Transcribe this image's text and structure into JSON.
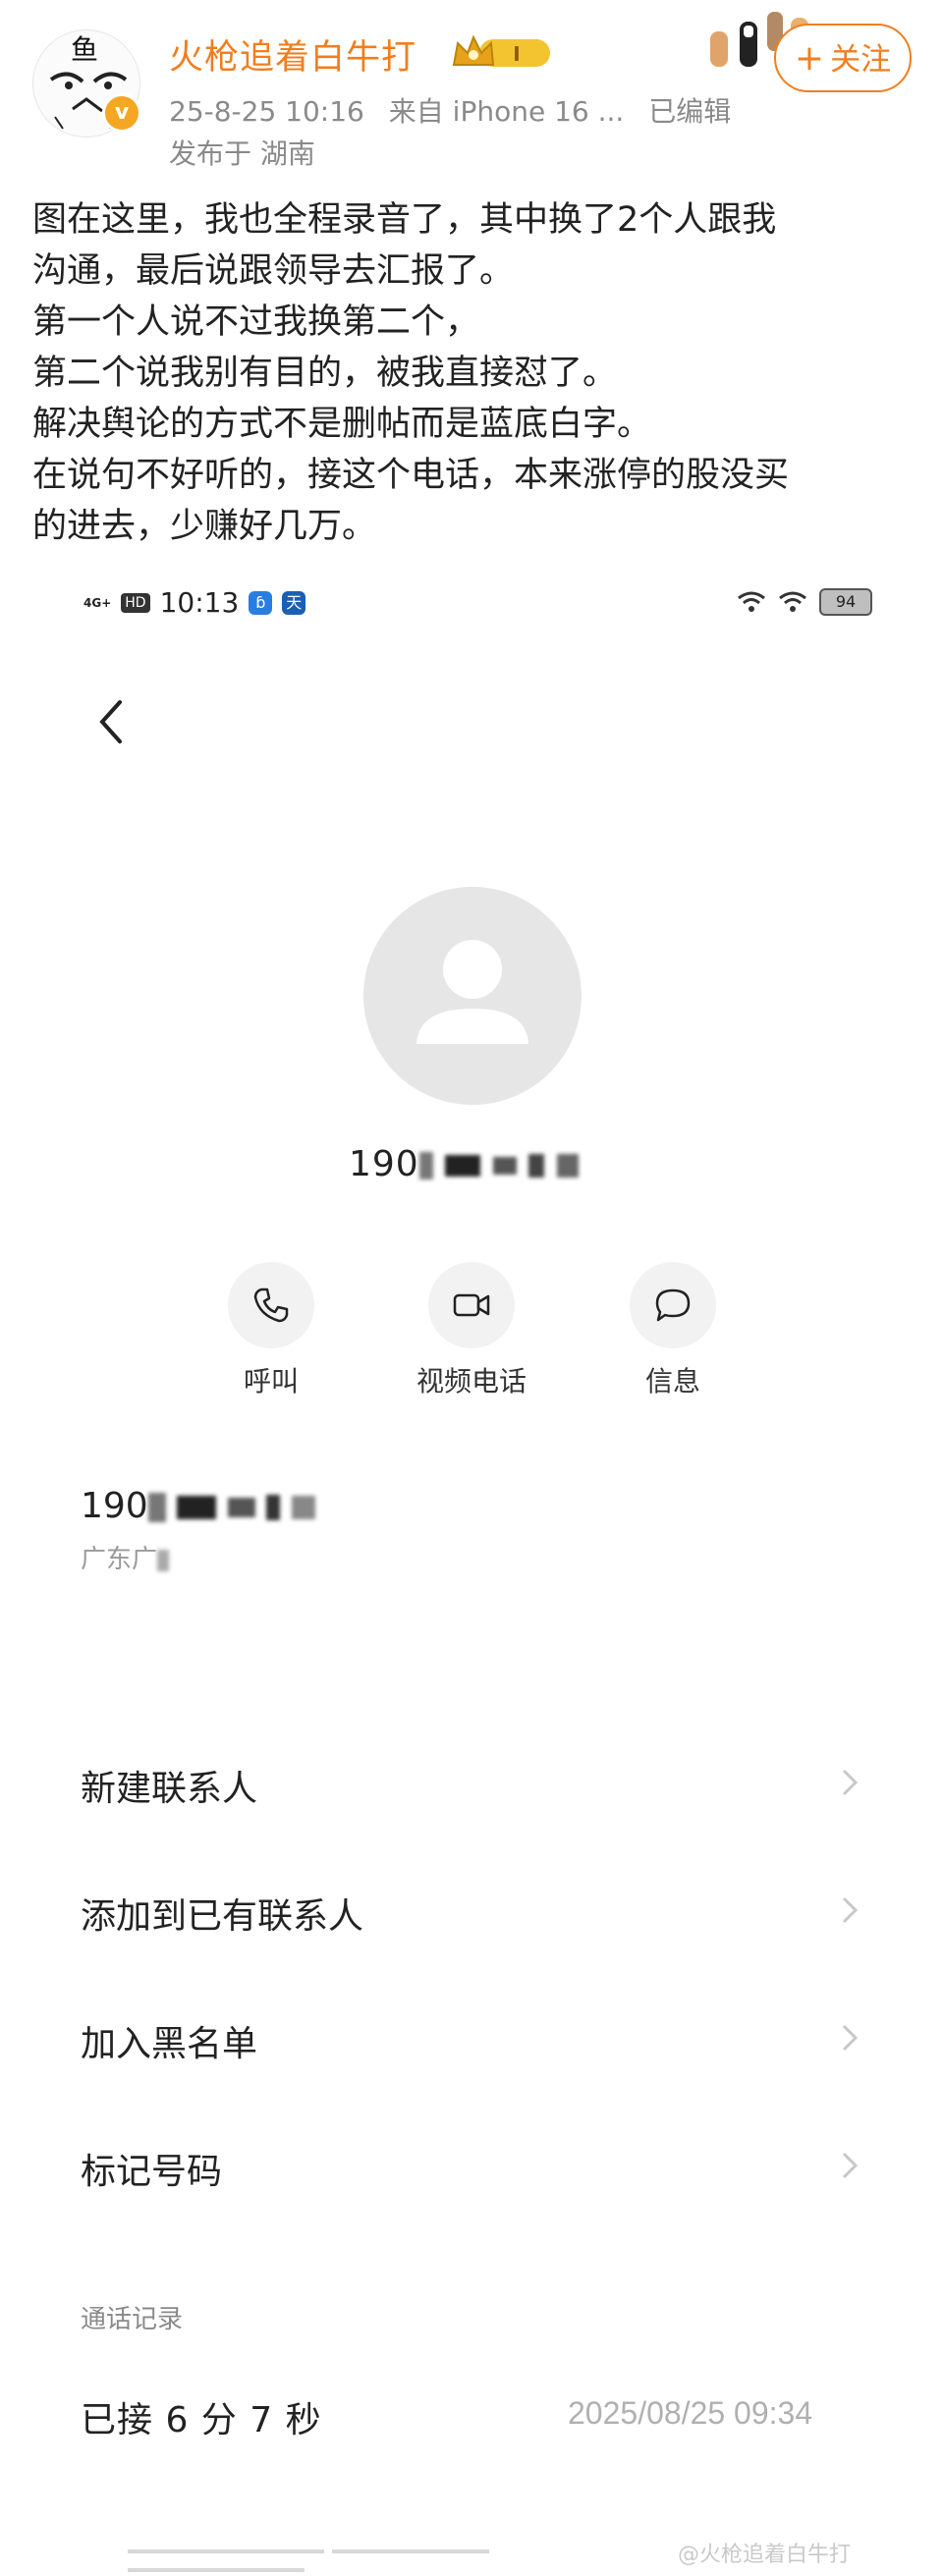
{
  "post": {
    "username": "火枪追着白牛打",
    "avatar_glyph": "鱼",
    "vip_level": "I",
    "date": "25-8-25 10:16",
    "source": "来自 iPhone 16 ...",
    "edited": "已编辑",
    "location": "发布于 湖南",
    "follow_label": "关注",
    "text_lines": [
      "图在这里，我也全程录音了，其中换了2个人跟我",
      "沟通，最后说跟领导去汇报了。",
      "第一个人说不过我换第二个，",
      "第二个说我别有目的，被我直接怼了。",
      "解决舆论的方式不是删帖而是蓝底白字。",
      "在说句不好听的，接这个电话，本来涨停的股没买",
      "的进去，少赚好几万。"
    ]
  },
  "phone": {
    "status": {
      "network": "4G+",
      "hd": "HD",
      "time": "10:13",
      "battery": "94"
    },
    "number_prefix": "190",
    "actions": {
      "call": "呼叫",
      "video": "视频电话",
      "message": "信息"
    },
    "detail_number_prefix": "190",
    "detail_location": "广东广",
    "menu": [
      "新建联系人",
      "添加到已有联系人",
      "加入黑名单",
      "标记号码"
    ],
    "call_log_title": "通话记录",
    "call_log_entry": "已接 6 分 7 秒",
    "call_log_time": "2025/08/25 09:34",
    "watermark": "@火枪追着白牛打"
  },
  "colors": {
    "accent": "#f07e1e",
    "gray_text": "#8a8a8a",
    "avatar_bg": "#e6e6e6"
  }
}
